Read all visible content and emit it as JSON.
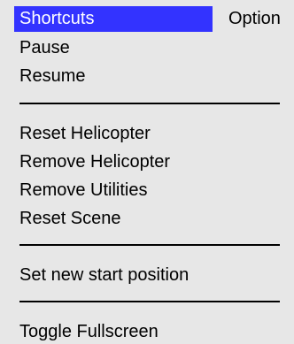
{
  "menubar": {
    "tabs": [
      {
        "label": "Shortcuts"
      },
      {
        "label": "Option"
      }
    ]
  },
  "menu": {
    "items": [
      {
        "label": "Pause"
      },
      {
        "label": "Resume"
      },
      {
        "label": "Reset Helicopter"
      },
      {
        "label": "Remove Helicopter"
      },
      {
        "label": "Remove Utilities"
      },
      {
        "label": "Reset Scene"
      },
      {
        "label": "Set new start position"
      },
      {
        "label": "Toggle Fullscreen"
      }
    ]
  },
  "colors": {
    "background": "#e7e7e7",
    "active_tab": "#3333ff",
    "active_text": "#ffffff",
    "text": "#000000"
  }
}
